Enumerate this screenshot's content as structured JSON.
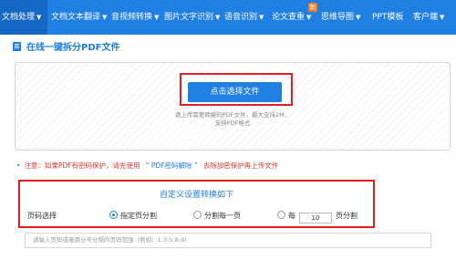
{
  "nav": {
    "items": [
      {
        "label": "文档处理"
      },
      {
        "label": "文档文本翻译"
      },
      {
        "label": "音视频转换"
      },
      {
        "label": "图片文字识别"
      },
      {
        "label": "语音识别"
      },
      {
        "label": "论文查重"
      },
      {
        "label": "思维导图"
      },
      {
        "label": "PPT模板"
      },
      {
        "label": "客户端"
      }
    ],
    "badge": "新"
  },
  "page": {
    "title": "在线一键拆分PDF文件"
  },
  "upload": {
    "button_label": "点击选择文件",
    "hint_line1": "请上传需要转换的PDF文件，最大支持2M，",
    "hint_line2": "支持PDF格式"
  },
  "notice": {
    "prefix": "注意：如果PDF有密码保护，请先使用",
    "link": "“ PDF密码解除 ”",
    "suffix": "去除加密保护再上传文件"
  },
  "settings": {
    "title": "自定义设置转换如下",
    "label": "页码选择",
    "option1": "指定页分割",
    "option2": "分割每一页",
    "option3_prefix": "每",
    "option3_value": "10",
    "option3_suffix": "页分割",
    "selected": "option1"
  },
  "range_input": {
    "placeholder": "请输入页码或者用分号分隔的页码范围（例如：1;3-5;8-9）"
  },
  "colors": {
    "primary": "#1f7fe3",
    "highlight": "#e02020",
    "notice_red": "#e53935"
  }
}
